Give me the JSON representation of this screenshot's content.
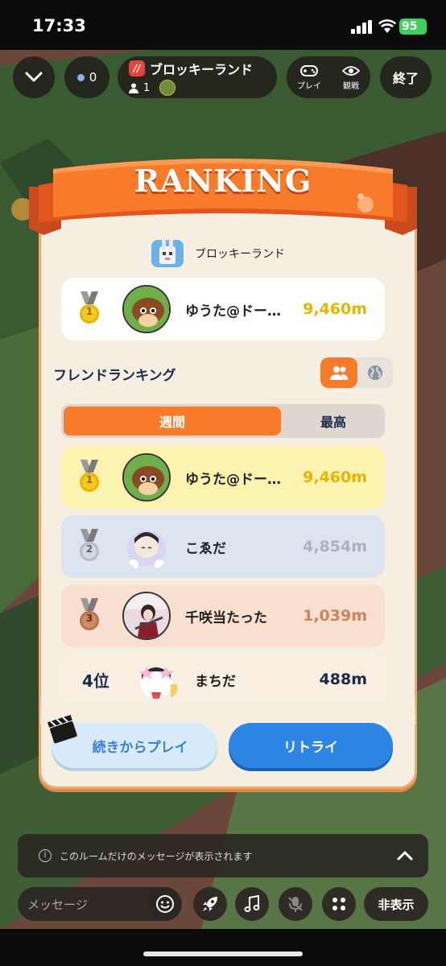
{
  "status_bar": {
    "time": "17:33",
    "battery": "95"
  },
  "header": {
    "viewer_count": "0",
    "room_title": "ブロッキーランド",
    "room_player_count": "1",
    "play_label": "プレイ",
    "spectate_label": "観戦",
    "end_label": "終了"
  },
  "ranking": {
    "banner": "RANKING",
    "game_name": "ブロッキーランド",
    "top": {
      "rank": "1",
      "name": "ゆうた@ドー…",
      "distance": "9,460m"
    },
    "section_title": "フレンドランキング",
    "tabs": [
      "週間",
      "最高"
    ],
    "entries": [
      {
        "rank": "1",
        "name": "ゆうた@ドー…",
        "distance": "9,460m"
      },
      {
        "rank": "2",
        "name": "こゑだ",
        "distance": "4,854m"
      },
      {
        "rank": "3",
        "name": "千咲当たった",
        "distance": "1,039m"
      },
      {
        "rank": "4位",
        "name": "まちだ",
        "distance": "488m"
      }
    ],
    "continue_label": "続きからプレイ",
    "retry_label": "リトライ"
  },
  "chat": {
    "notice": "このルームだけのメッセージが表示されます",
    "input_placeholder": "メッセージ",
    "hide_label": "非表示"
  },
  "colors": {
    "accent": "#f77b2a",
    "gold": "#e8b400",
    "silver": "#a9b3bf",
    "bronze": "#c98560",
    "primary_blue": "#2e86e4"
  }
}
